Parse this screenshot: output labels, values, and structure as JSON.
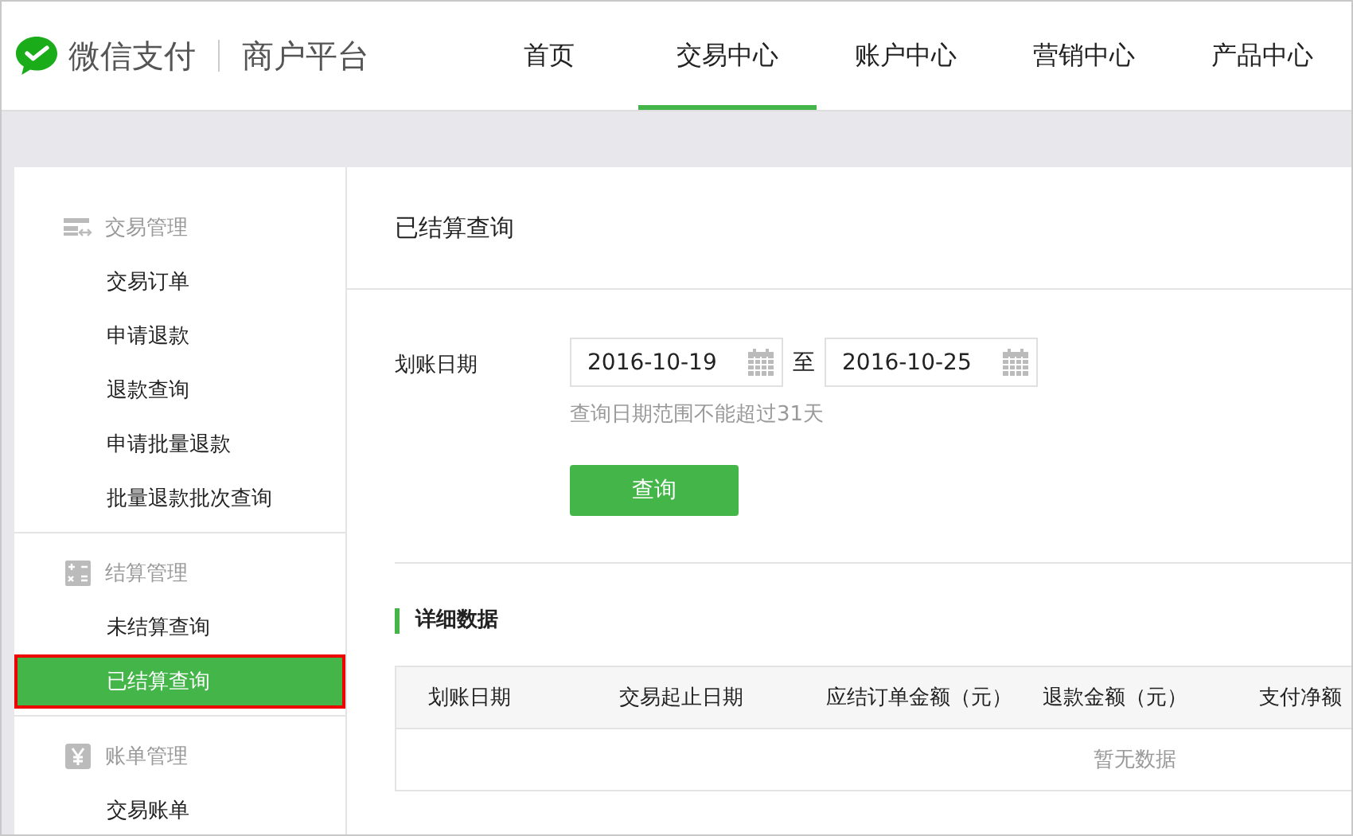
{
  "header": {
    "brand": "微信支付",
    "platform": "商户平台"
  },
  "nav": [
    {
      "label": "首页",
      "selected": false
    },
    {
      "label": "交易中心",
      "selected": true
    },
    {
      "label": "账户中心",
      "selected": false
    },
    {
      "label": "营销中心",
      "selected": false
    },
    {
      "label": "产品中心",
      "selected": false
    }
  ],
  "sidebar": {
    "groups": [
      {
        "kind": "transfer",
        "title": "交易管理",
        "items": [
          {
            "label": "交易订单",
            "selected": false
          },
          {
            "label": "申请退款",
            "selected": false
          },
          {
            "label": "退款查询",
            "selected": false
          },
          {
            "label": "申请批量退款",
            "selected": false
          },
          {
            "label": "批量退款批次查询",
            "selected": false
          }
        ]
      },
      {
        "kind": "calculator",
        "title": "结算管理",
        "items": [
          {
            "label": "未结算查询",
            "selected": false
          },
          {
            "label": "已结算查询",
            "selected": true
          }
        ]
      },
      {
        "kind": "yen",
        "title": "账单管理",
        "items": [
          {
            "label": "交易账单",
            "selected": false
          }
        ]
      }
    ]
  },
  "page_title": "已结算查询",
  "form": {
    "label": "划账日期",
    "start_date": "2016-10-19",
    "separator": "至",
    "end_date": "2016-10-25",
    "hint": "查询日期范围不能超过31天",
    "submit": "查询"
  },
  "detail": {
    "title": "详细数据",
    "table": {
      "columns": [
        "划账日期",
        "交易起止日期",
        "应结订单金额（元）",
        "退款金额（元）",
        "支付净额"
      ],
      "empty_text": "暂无数据"
    }
  }
}
